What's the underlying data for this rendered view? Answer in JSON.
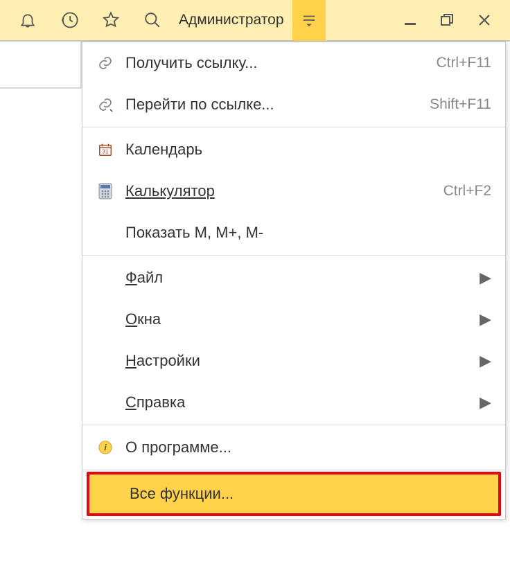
{
  "toolbar": {
    "user_label": "Администратор"
  },
  "menu": {
    "items": [
      {
        "label": "Получить ссылку...",
        "shortcut": "Ctrl+F11",
        "underline": -1
      },
      {
        "label": "Перейти по ссылке...",
        "shortcut": "Shift+F11",
        "underline": -1
      },
      {
        "label": "Календарь",
        "shortcut": "",
        "underline": -1
      },
      {
        "label": "Калькулятор",
        "shortcut": "Ctrl+F2",
        "underline": 0
      },
      {
        "label": "Показать M, M+, M-",
        "shortcut": "",
        "underline": -1
      },
      {
        "label": "Файл",
        "shortcut": "",
        "underline": 0,
        "submenu": true
      },
      {
        "label": "Окна",
        "shortcut": "",
        "underline": 0,
        "submenu": true
      },
      {
        "label": "Настройки",
        "shortcut": "",
        "underline": 0,
        "submenu": true
      },
      {
        "label": "Справка",
        "shortcut": "",
        "underline": 0,
        "submenu": true
      },
      {
        "label": "О программе...",
        "shortcut": "",
        "underline": -1
      },
      {
        "label": "Все функции...",
        "shortcut": "",
        "underline": -1
      }
    ]
  }
}
